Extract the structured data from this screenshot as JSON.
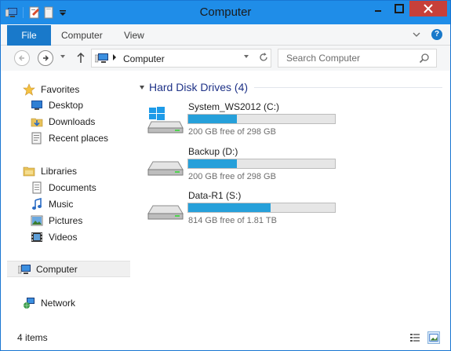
{
  "window": {
    "title": "Computer"
  },
  "ribbon": {
    "tabs": [
      "File",
      "Computer",
      "View"
    ]
  },
  "address": {
    "path": "Computer"
  },
  "search": {
    "placeholder": "Search Computer"
  },
  "sidebar": {
    "favorites_label": "Favorites",
    "favorites": [
      "Desktop",
      "Downloads",
      "Recent places"
    ],
    "libraries_label": "Libraries",
    "libraries": [
      "Documents",
      "Music",
      "Pictures",
      "Videos"
    ],
    "computer_label": "Computer",
    "network_label": "Network"
  },
  "main": {
    "group_title": "Hard Disk Drives (4)",
    "drives": [
      {
        "name": "System_WS2012 (C:)",
        "free": "200 GB free of 298 GB",
        "used_fraction": 0.33,
        "icon": "windows-drive-icon"
      },
      {
        "name": "Backup (D:)",
        "free": "200 GB free of 298 GB",
        "used_fraction": 0.33,
        "icon": "hard-drive-icon"
      },
      {
        "name": "Data-R1 (S:)",
        "free": "814 GB free of 1.81 TB",
        "used_fraction": 0.56,
        "icon": "hard-drive-icon"
      }
    ]
  },
  "status": {
    "items": "4 items"
  },
  "colors": {
    "titlebar": "#1f8de8",
    "close": "#c7403a",
    "file_tab": "#1979ca",
    "drive_fill": "#26a0da",
    "group_title": "#1e3287"
  }
}
